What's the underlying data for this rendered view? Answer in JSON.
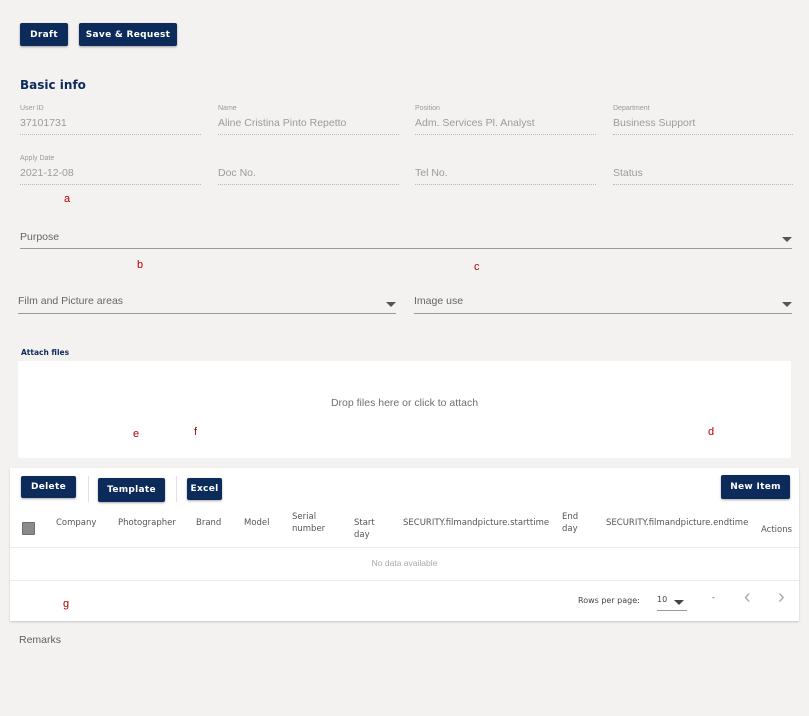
{
  "toolbar": {
    "draft_label": "Draft",
    "save_request_label": "Save & Request"
  },
  "basic_info": {
    "title": "Basic info",
    "fields": [
      {
        "label": "User ID",
        "value": "37101731"
      },
      {
        "label": "Name",
        "value": "Aline Cristina Pinto Repetto"
      },
      {
        "label": "Position",
        "value": "Adm. Services Pl. Analyst"
      },
      {
        "label": "Department",
        "value": "Business Support"
      },
      {
        "label": "Apply Date",
        "value": "2021-12-08"
      },
      {
        "label": "",
        "placeholder": "Doc No."
      },
      {
        "label": "",
        "placeholder": "Tel No."
      },
      {
        "label": "",
        "placeholder": "Status"
      }
    ]
  },
  "purpose": {
    "placeholder": "Purpose"
  },
  "film_areas": {
    "placeholder": "Film and Picture areas"
  },
  "image_use": {
    "placeholder": "Image use"
  },
  "attach": {
    "label": "Attach files",
    "drop_text": "Drop files here or click to attach"
  },
  "markers": {
    "a": "a",
    "b": "b",
    "c": "c",
    "d": "d",
    "e": "e",
    "f": "f",
    "g": "g"
  },
  "table": {
    "buttons": {
      "delete": "Delete",
      "template": "Template",
      "excel": "Excel",
      "new_item": "New Item"
    },
    "columns": {
      "company": "Company",
      "photographer": "Photographer",
      "brand": "Brand",
      "model": "Model",
      "serial_number": "Serial number",
      "start_day": "Start day",
      "starttime": "SECURITY.filmandpicture.starttime",
      "end_day": "End day",
      "endtime": "SECURITY.filmandpicture.endtime",
      "actions": "Actions"
    },
    "empty_text": "No data available",
    "rows_per_page_label": "Rows per page:",
    "rows_per_page_value": "10",
    "range_text": "-"
  },
  "remarks": {
    "label": "Remarks"
  },
  "colors": {
    "primary": "#0c2b5b",
    "marker": "#b00000",
    "background": "#f4f2f1"
  }
}
